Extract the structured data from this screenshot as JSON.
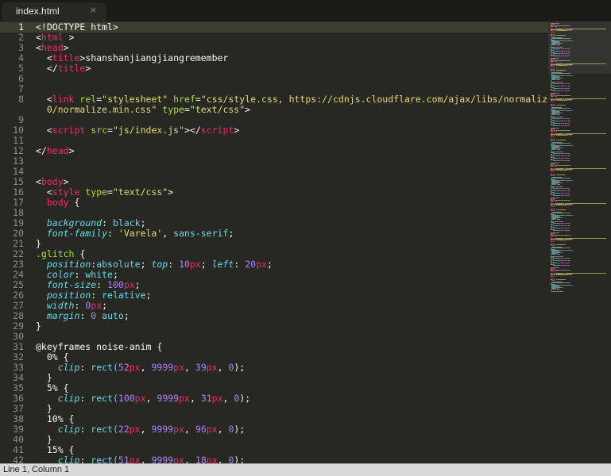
{
  "tab": {
    "title": "index.html",
    "close_glyph": "×",
    "close_icon": "close-icon"
  },
  "status": {
    "position": "Line 1, Column 1"
  },
  "theme": {
    "tag": "#f92672",
    "attr": "#a6e22e",
    "string": "#e6db74",
    "property": "#66d9ef",
    "number": "#ae81ff",
    "plain": "#f8f8f2",
    "gutter": "#8f908a",
    "background": "#272822"
  },
  "active_line": 1,
  "lines": [
    [
      [
        "plain",
        "<!DOCTYPE html>"
      ]
    ],
    [
      [
        "plain",
        "<"
      ],
      [
        "tag",
        "html"
      ],
      [
        "plain",
        " >"
      ]
    ],
    [
      [
        "plain",
        "<"
      ],
      [
        "tag",
        "head"
      ],
      [
        "plain",
        ">"
      ]
    ],
    [
      [
        "plain",
        "  <"
      ],
      [
        "tag",
        "title"
      ],
      [
        "plain",
        ">shanshanjiangjiangremember"
      ]
    ],
    [
      [
        "plain",
        "  </"
      ],
      [
        "tag",
        "title"
      ],
      [
        "plain",
        ">"
      ]
    ],
    [],
    [],
    [
      [
        "plain",
        "  <"
      ],
      [
        "tag",
        "link"
      ],
      [
        "plain",
        " "
      ],
      [
        "attr",
        "rel"
      ],
      [
        "plain",
        "="
      ],
      [
        "str",
        "\"stylesheet\""
      ],
      [
        "plain",
        " "
      ],
      [
        "attr",
        "href"
      ],
      [
        "plain",
        "="
      ],
      [
        "str",
        "\"css/style.css, https://cdnjs.cloudflare.com/ajax/libs/normalize/5.0."
      ]
    ],
    [
      [
        "str",
        "  0/normalize.min.css\""
      ],
      [
        "plain",
        " "
      ],
      [
        "attr",
        "type"
      ],
      [
        "plain",
        "="
      ],
      [
        "str",
        "\"text/css\""
      ],
      [
        "plain",
        ">"
      ]
    ],
    [
      [
        "plain",
        "  <"
      ],
      [
        "tag",
        "script"
      ],
      [
        "plain",
        " "
      ],
      [
        "attr",
        "src"
      ],
      [
        "plain",
        "="
      ],
      [
        "str",
        "\"js/index.js\""
      ],
      [
        "plain",
        "></"
      ],
      [
        "tag",
        "script"
      ],
      [
        "plain",
        ">"
      ]
    ],
    [],
    [
      [
        "plain",
        "</"
      ],
      [
        "tag",
        "head"
      ],
      [
        "plain",
        ">"
      ]
    ],
    [],
    [],
    [
      [
        "plain",
        "<"
      ],
      [
        "tag",
        "body"
      ],
      [
        "plain",
        ">"
      ]
    ],
    [
      [
        "plain",
        "  <"
      ],
      [
        "tag",
        "style"
      ],
      [
        "plain",
        " "
      ],
      [
        "attr",
        "type"
      ],
      [
        "plain",
        "="
      ],
      [
        "str",
        "\"text/css\""
      ],
      [
        "plain",
        ">"
      ]
    ],
    [
      [
        "plain",
        "  "
      ],
      [
        "tag",
        "body"
      ],
      [
        "plain",
        " {"
      ]
    ],
    [],
    [
      [
        "plain",
        "  "
      ],
      [
        "prop",
        "background"
      ],
      [
        "plain",
        ": "
      ],
      [
        "val",
        "black"
      ],
      [
        "plain",
        ";"
      ]
    ],
    [
      [
        "plain",
        "  "
      ],
      [
        "prop",
        "font-family"
      ],
      [
        "plain",
        ": "
      ],
      [
        "str",
        "'Varela'"
      ],
      [
        "plain",
        ", "
      ],
      [
        "val",
        "sans-serif"
      ],
      [
        "plain",
        ";"
      ]
    ],
    [
      [
        "plain",
        "}"
      ]
    ],
    [
      [
        "sel",
        ".glitch"
      ],
      [
        "plain",
        " {"
      ]
    ],
    [
      [
        "plain",
        "  "
      ],
      [
        "prop",
        "position"
      ],
      [
        "plain",
        ":"
      ],
      [
        "val",
        "absolute"
      ],
      [
        "plain",
        "; "
      ],
      [
        "prop",
        "top"
      ],
      [
        "plain",
        ": "
      ],
      [
        "num",
        "10"
      ],
      [
        "unit",
        "px"
      ],
      [
        "plain",
        "; "
      ],
      [
        "prop",
        "left"
      ],
      [
        "plain",
        ": "
      ],
      [
        "num",
        "20"
      ],
      [
        "unit",
        "px"
      ],
      [
        "plain",
        ";"
      ]
    ],
    [
      [
        "plain",
        "  "
      ],
      [
        "prop",
        "color"
      ],
      [
        "plain",
        ": "
      ],
      [
        "val",
        "white"
      ],
      [
        "plain",
        ";"
      ]
    ],
    [
      [
        "plain",
        "  "
      ],
      [
        "prop",
        "font-size"
      ],
      [
        "plain",
        ": "
      ],
      [
        "num",
        "100"
      ],
      [
        "unit",
        "px"
      ],
      [
        "plain",
        ";"
      ]
    ],
    [
      [
        "plain",
        "  "
      ],
      [
        "prop",
        "position"
      ],
      [
        "plain",
        ": "
      ],
      [
        "val",
        "relative"
      ],
      [
        "plain",
        ";"
      ]
    ],
    [
      [
        "plain",
        "  "
      ],
      [
        "prop",
        "width"
      ],
      [
        "plain",
        ": "
      ],
      [
        "num",
        "0"
      ],
      [
        "unit",
        "px"
      ],
      [
        "plain",
        ";"
      ]
    ],
    [
      [
        "plain",
        "  "
      ],
      [
        "prop",
        "margin"
      ],
      [
        "plain",
        ": "
      ],
      [
        "num",
        "0"
      ],
      [
        "plain",
        " "
      ],
      [
        "val",
        "auto"
      ],
      [
        "plain",
        ";"
      ]
    ],
    [
      [
        "plain",
        "}"
      ]
    ],
    [],
    [
      [
        "plain",
        "@keyframes noise-anim {"
      ]
    ],
    [
      [
        "plain",
        "  0% {"
      ]
    ],
    [
      [
        "plain",
        "    "
      ],
      [
        "prop",
        "clip"
      ],
      [
        "plain",
        ": "
      ],
      [
        "val",
        "rect("
      ],
      [
        "num",
        "52"
      ],
      [
        "unit",
        "px"
      ],
      [
        "plain",
        ", "
      ],
      [
        "num",
        "9999"
      ],
      [
        "unit",
        "px"
      ],
      [
        "plain",
        ", "
      ],
      [
        "num",
        "39"
      ],
      [
        "unit",
        "px"
      ],
      [
        "plain",
        ", "
      ],
      [
        "num",
        "0"
      ],
      [
        "plain",
        ");"
      ]
    ],
    [
      [
        "plain",
        "  }"
      ]
    ],
    [
      [
        "plain",
        "  5% {"
      ]
    ],
    [
      [
        "plain",
        "    "
      ],
      [
        "prop",
        "clip"
      ],
      [
        "plain",
        ": "
      ],
      [
        "val",
        "rect("
      ],
      [
        "num",
        "100"
      ],
      [
        "unit",
        "px"
      ],
      [
        "plain",
        ", "
      ],
      [
        "num",
        "9999"
      ],
      [
        "unit",
        "px"
      ],
      [
        "plain",
        ", "
      ],
      [
        "num",
        "31"
      ],
      [
        "unit",
        "px"
      ],
      [
        "plain",
        ", "
      ],
      [
        "num",
        "0"
      ],
      [
        "plain",
        ");"
      ]
    ],
    [
      [
        "plain",
        "  }"
      ]
    ],
    [
      [
        "plain",
        "  10% {"
      ]
    ],
    [
      [
        "plain",
        "    "
      ],
      [
        "prop",
        "clip"
      ],
      [
        "plain",
        ": "
      ],
      [
        "val",
        "rect("
      ],
      [
        "num",
        "22"
      ],
      [
        "unit",
        "px"
      ],
      [
        "plain",
        ", "
      ],
      [
        "num",
        "9999"
      ],
      [
        "unit",
        "px"
      ],
      [
        "plain",
        ", "
      ],
      [
        "num",
        "96"
      ],
      [
        "unit",
        "px"
      ],
      [
        "plain",
        ", "
      ],
      [
        "num",
        "0"
      ],
      [
        "plain",
        ");"
      ]
    ],
    [
      [
        "plain",
        "  }"
      ]
    ],
    [
      [
        "plain",
        "  15% {"
      ]
    ],
    [
      [
        "plain",
        "    "
      ],
      [
        "prop",
        "clip"
      ],
      [
        "plain",
        ": "
      ],
      [
        "val",
        "rect("
      ],
      [
        "num",
        "51"
      ],
      [
        "unit",
        "px"
      ],
      [
        "plain",
        ", "
      ],
      [
        "num",
        "9999"
      ],
      [
        "unit",
        "px"
      ],
      [
        "plain",
        ", "
      ],
      [
        "num",
        "18"
      ],
      [
        "unit",
        "px"
      ],
      [
        "plain",
        ", "
      ],
      [
        "num",
        "0"
      ],
      [
        "plain",
        ");"
      ]
    ]
  ]
}
